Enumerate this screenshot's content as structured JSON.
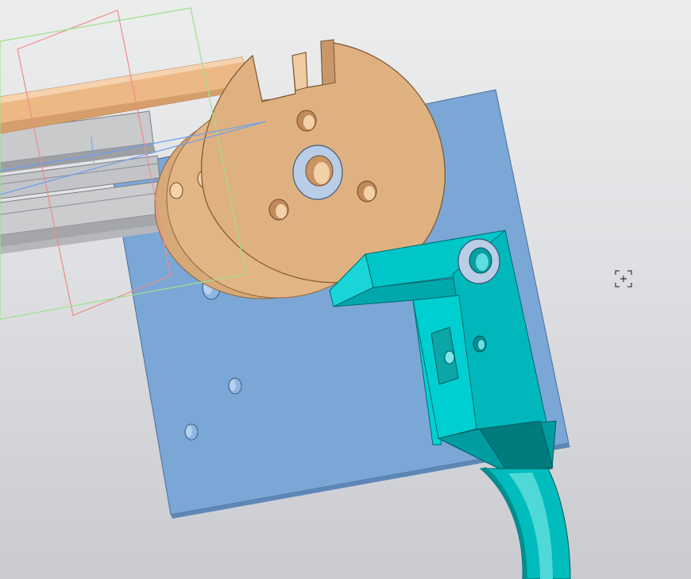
{
  "app": {
    "type": "cad-3d-viewport"
  },
  "scene": {
    "background_top": "#eceded",
    "background_bottom": "#c9cbd0",
    "parts": [
      {
        "name": "base-plate",
        "color": "#7ba7d7"
      },
      {
        "name": "rotary-disc",
        "color": "#dfb17f"
      },
      {
        "name": "rod",
        "color": "#e9b787"
      },
      {
        "name": "aluminum-rails",
        "color": "#b9bbbe"
      },
      {
        "name": "bracket-arm",
        "color": "#00c5c8"
      },
      {
        "name": "curved-hook",
        "color": "#00b9ba"
      }
    ],
    "selection_frames": [
      {
        "name": "red-frame",
        "color": "#f08a8a"
      },
      {
        "name": "green-frame",
        "color": "#9fe08a"
      }
    ]
  },
  "cursor": {
    "icon": "crosshair-select-icon"
  }
}
